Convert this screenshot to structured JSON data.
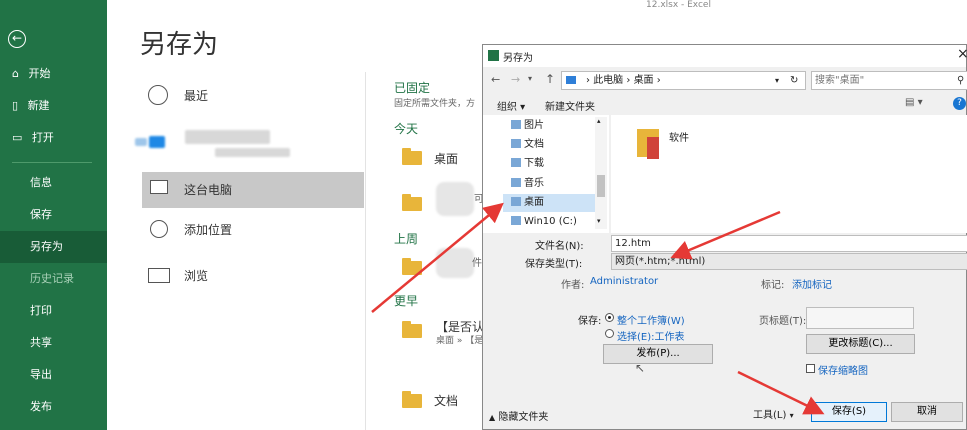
{
  "window_title": "12.xlsx  -  Excel",
  "rail": {
    "back_glyph": "⊖",
    "top_items": [
      {
        "label": "开始",
        "icon": "home-icon"
      },
      {
        "label": "新建",
        "icon": "new-file-icon"
      },
      {
        "label": "打开",
        "icon": "open-folder-icon"
      }
    ],
    "items": [
      {
        "label": "信息"
      },
      {
        "label": "保存"
      },
      {
        "label": "另存为",
        "selected": true
      },
      {
        "label": "历史记录",
        "muted": true
      },
      {
        "label": "打印"
      },
      {
        "label": "共享"
      },
      {
        "label": "导出"
      },
      {
        "label": "发布"
      }
    ]
  },
  "page_title": "另存为",
  "locations": {
    "recent": "最近",
    "this_pc": "这台电脑",
    "add_place": "添加位置",
    "browse": "浏览"
  },
  "files_panel": {
    "pinned_heading": "已固定",
    "pinned_hint": "固定所需文件夹，方",
    "today_heading": "今天",
    "today_item": "桌面",
    "last_week_heading": "上周",
    "earlier_heading": "更早",
    "earlier_item_title": "【是否认",
    "earlier_item_path": "桌面 » 【是",
    "bottom_item": "文档",
    "blurred_tail_1": "可",
    "blurred_tail_2": "件"
  },
  "dialog": {
    "title": "另存为",
    "close_glyph": "×",
    "breadcrumb": [
      "此电脑",
      "桌面"
    ],
    "search_placeholder": "搜索\"桌面\"",
    "toolbar": {
      "organize": "组织 ▾",
      "new_folder": "新建文件夹"
    },
    "tree": [
      {
        "label": "图片"
      },
      {
        "label": "文档"
      },
      {
        "label": "下载"
      },
      {
        "label": "音乐"
      },
      {
        "label": "桌面",
        "selected": true
      },
      {
        "label": "Win10 (C:)"
      }
    ],
    "content_items": [
      {
        "label": "软件"
      }
    ],
    "filename_label": "文件名(N):",
    "filename_value": "12.htm",
    "filetype_label": "保存类型(T):",
    "filetype_value": "网页(*.htm;*.html)",
    "author_label": "作者:",
    "author_value": "Administrator",
    "tags_label": "标记:",
    "tags_value": "添加标记",
    "save_label": "保存:",
    "radio_entire": "整个工作簿(W)",
    "radio_selection": "选择(E):工作表",
    "publish_button": "发布(P)...",
    "page_title_label": "页标题(T):",
    "change_title_button": "更改标题(C)...",
    "save_thumbnail": "保存缩略图",
    "hide_folders": "隐藏文件夹",
    "tools_button": "工具(L)",
    "save_button": "保存(S)",
    "cancel_button": "取消"
  },
  "colors": {
    "rail_green": "#217346",
    "annotation_red": "#e53935",
    "link_blue": "#1565c0"
  }
}
